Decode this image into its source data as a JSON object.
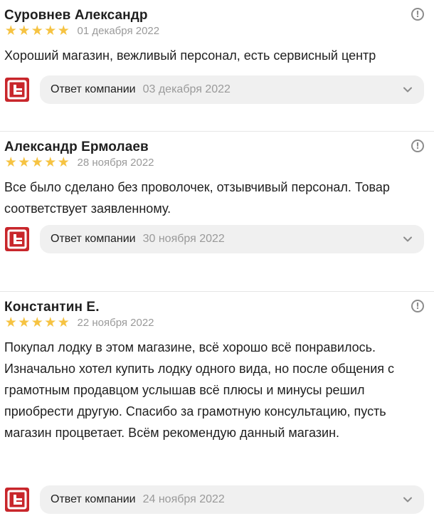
{
  "reviews": [
    {
      "author": "Суровнев Александр",
      "rating": 5,
      "date": "01 декабря 2022",
      "text": "Хороший магазин, вежливый персонал, есть сервисный центр",
      "reply": {
        "label": "Ответ компании",
        "date": "03 декабря 2022"
      }
    },
    {
      "author": "Александр Ермолаев",
      "rating": 5,
      "date": "28 ноября 2022",
      "text": "Все было сделано без проволочек, отзывчивый персонал. Товар соответствует заявленному.",
      "reply": {
        "label": "Ответ компании",
        "date": "30 ноября 2022"
      }
    },
    {
      "author": "Константин Е.",
      "rating": 5,
      "date": "22 ноября 2022",
      "text": "Покупал лодку в этом магазине, всё хорошо всё понравилось. Изначально хотел купить лодку одного вида, но после общения с грамотным продавцом услышав всё плюсы и минусы решил приобрести другую. Спасибо за грамотную консультацию, пусть магазин процветает. Всём рекомендую данный магазин.",
      "reply": {
        "label": "Ответ компании",
        "date": "24 ноября 2022"
      }
    }
  ],
  "icons": {
    "star": "star-icon",
    "report": "exclamation-circle-icon",
    "company_logo": "company-logo-icon",
    "expand": "chevron-down-icon"
  },
  "colors": {
    "star": "#f6c342",
    "logo": "#c8262b",
    "pill_bg": "#f0f0f0",
    "muted_text": "#9a9a9a"
  }
}
